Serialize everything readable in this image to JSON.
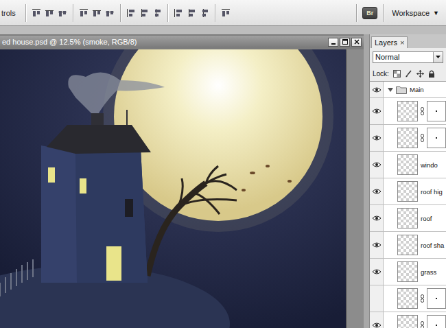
{
  "toolbar": {
    "options_label": "trols",
    "bridge_logo": "Br",
    "workspace": {
      "label": "Workspace",
      "arrow": "▼"
    }
  },
  "document": {
    "title": "ed house.psd @ 12.5% (smoke, RGB/8)"
  },
  "layers_panel": {
    "tab": {
      "label": "Layers",
      "close": "×",
      "selected": true
    },
    "blend_mode": {
      "value": "Normal"
    },
    "lock": {
      "label": "Lock:"
    },
    "layers": [
      {
        "kind": "group",
        "name": "Main",
        "visible": true,
        "expanded": true
      },
      {
        "kind": "masked",
        "visible": true
      },
      {
        "kind": "masked",
        "visible": true
      },
      {
        "kind": "layer",
        "name": "windo",
        "visible": true
      },
      {
        "kind": "layer",
        "name": "roof hig",
        "visible": true
      },
      {
        "kind": "layer",
        "name": "roof",
        "visible": true
      },
      {
        "kind": "layer",
        "name": "roof sha",
        "visible": true
      },
      {
        "kind": "layer",
        "name": "grass",
        "visible": true
      },
      {
        "kind": "masked",
        "visible": false
      },
      {
        "kind": "masked",
        "visible": true
      }
    ]
  }
}
